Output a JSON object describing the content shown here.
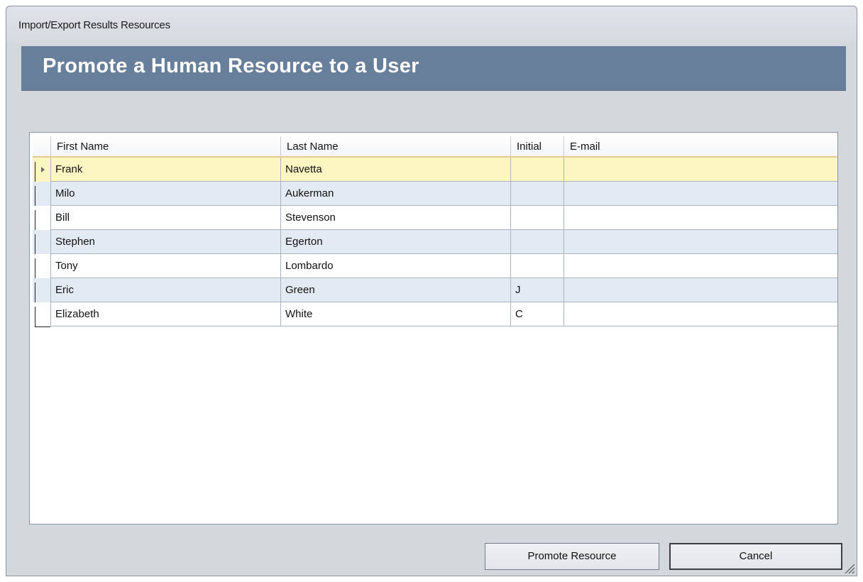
{
  "window": {
    "title": "Import/Export Results Resources"
  },
  "banner": {
    "title": "Promote a Human Resource to a User"
  },
  "grid": {
    "columns": [
      "First Name",
      "Last Name",
      "Initial",
      "E-mail"
    ],
    "rows": [
      {
        "first": "Frank",
        "last": "Navetta",
        "initial": "",
        "email": ""
      },
      {
        "first": "Milo",
        "last": "Aukerman",
        "initial": "",
        "email": ""
      },
      {
        "first": "Bill",
        "last": "Stevenson",
        "initial": "",
        "email": ""
      },
      {
        "first": "Stephen",
        "last": "Egerton",
        "initial": "",
        "email": ""
      },
      {
        "first": "Tony",
        "last": "Lombardo",
        "initial": "",
        "email": ""
      },
      {
        "first": "Eric",
        "last": "Green",
        "initial": "J",
        "email": ""
      },
      {
        "first": "Elizabeth",
        "last": "White",
        "initial": "C",
        "email": ""
      }
    ],
    "selected_row": 0
  },
  "buttons": {
    "promote_label": "Promote Resource",
    "cancel_label": "Cancel"
  },
  "colors": {
    "banner": "#687f9b",
    "selected_row": "#fdf6c3",
    "alt_row": "#e4eaf3",
    "header_underline": "#e7c993"
  },
  "icons": {
    "row_indicator": "row-pointer-icon",
    "resize": "resize-grip-icon"
  }
}
